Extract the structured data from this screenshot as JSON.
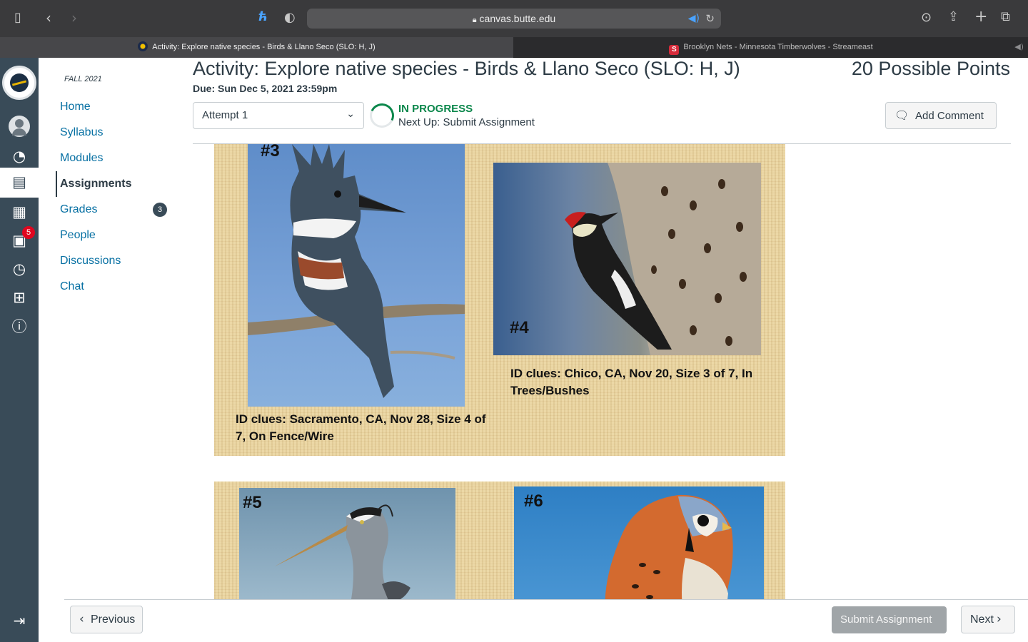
{
  "browser": {
    "url": "canvas.butte.edu",
    "tabs": [
      {
        "title": "Activity: Explore native species - Birds & Llano Seco (SLO: H, J)"
      },
      {
        "title": "Brooklyn Nets - Minnesota Timberwolves - Streameast"
      }
    ],
    "icons": [
      "sidebar-icon",
      "back-icon",
      "forward-icon",
      "extension-icon",
      "shield-icon",
      "lock-icon",
      "audio-icon",
      "reload-icon",
      "download-icon",
      "share-icon",
      "new-tab-icon",
      "tabs-overview-icon"
    ]
  },
  "global_nav": {
    "items": [
      "account",
      "dashboard",
      "courses",
      "calendar",
      "inbox",
      "history",
      "studio",
      "help"
    ],
    "inbox_badge": "5"
  },
  "course_nav": {
    "term": "FALL 2021",
    "items": [
      {
        "label": "Home"
      },
      {
        "label": "Syllabus"
      },
      {
        "label": "Modules"
      },
      {
        "label": "Assignments"
      },
      {
        "label": "Grades"
      },
      {
        "label": "People"
      },
      {
        "label": "Discussions"
      },
      {
        "label": "Chat"
      }
    ],
    "active": "Assignments",
    "grades_badge": "3"
  },
  "assignment": {
    "title": "Activity: Explore native species - Birds & Llano Seco (SLO: H, J)",
    "points": "20 Possible Points",
    "due": "Due: Sun Dec 5, 2021 23:59pm",
    "attempt": "Attempt 1",
    "status": "IN PROGRESS",
    "next_up": "Next Up: Submit Assignment",
    "add_comment": "Add Comment"
  },
  "slides": [
    {
      "birds": [
        {
          "number": "#3",
          "clue_line1": "ID clues: Sacramento, CA, Nov 28, Size 4 of",
          "clue_line2": "7, On Fence/Wire"
        },
        {
          "number": "#4",
          "clue_line1": "ID clues: Chico, CA, Nov 20, Size 3 of 7, In",
          "clue_line2": "Trees/Bushes"
        }
      ]
    },
    {
      "birds": [
        {
          "number": "#5"
        },
        {
          "number": "#6"
        }
      ]
    }
  ],
  "footer": {
    "previous": "Previous",
    "submit": "Submit Assignment",
    "next": "Next"
  },
  "colors": {
    "link": "#0770a3",
    "text": "#2d3b45",
    "success": "#0b874b",
    "global_nav_bg": "#394b58",
    "badge": "#e0061f"
  }
}
